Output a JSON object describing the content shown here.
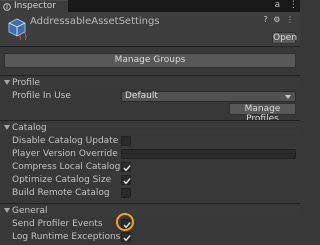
{
  "tab": {
    "title": "Inspector",
    "icon": "inspector-info-icon"
  },
  "tab_menu": {
    "lock": "a",
    "more": "⋮"
  },
  "header": {
    "asset_icon": "addressable-settings-icon",
    "title": "AddressableAssetSettings",
    "icons": [
      "help-icon",
      "settings-icon",
      "more-icon"
    ],
    "open_button": "Open"
  },
  "manage_groups_button": "Manage Groups",
  "sections": {
    "profile": {
      "title": "Profile",
      "profile_in_use_label": "Profile In Use",
      "profile_in_use_value": "Default",
      "manage_profiles_button": "Manage Profiles"
    },
    "catalog": {
      "title": "Catalog",
      "items": [
        {
          "label": "Disable Catalog Update on St",
          "checked": false
        },
        {
          "label": "Player Version Override",
          "value": ""
        },
        {
          "label": "Compress Local Catalog",
          "checked": true
        },
        {
          "label": "Optimize Catalog Size",
          "checked": true
        },
        {
          "label": "Build Remote Catalog",
          "checked": false
        }
      ]
    },
    "general": {
      "title": "General",
      "items": [
        {
          "label": "Send Profiler Events",
          "checked": true
        },
        {
          "label": "Log Runtime Exceptions",
          "checked": true
        }
      ]
    }
  },
  "colors": {
    "highlight": "#f2a12e",
    "panel": "#383838"
  }
}
